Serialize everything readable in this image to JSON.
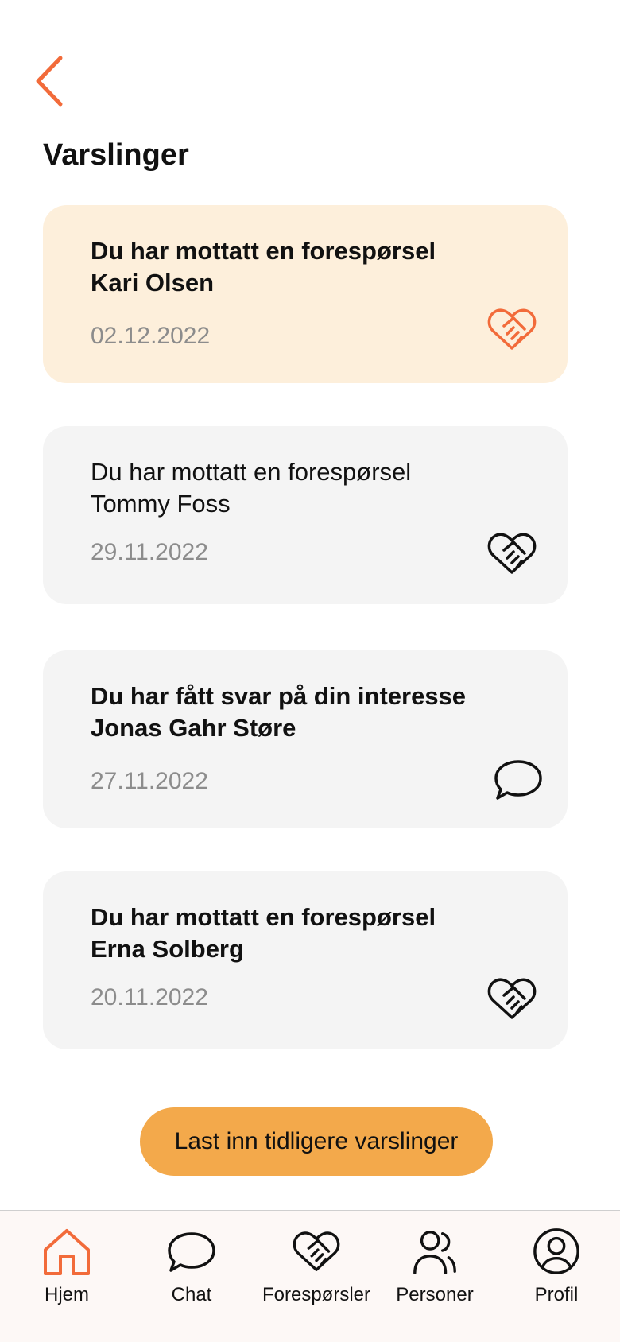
{
  "header": {
    "back_icon": "chevron-left-icon",
    "title": "Varslinger"
  },
  "notifications": [
    {
      "title": "Du har mottatt en forespørsel",
      "name": "Kari Olsen",
      "date": "02.12.2022",
      "icon": "handshake-heart-icon",
      "highlighted": true,
      "bold": true
    },
    {
      "title": "Du har mottatt en forespørsel",
      "name": "Tommy Foss",
      "date": "29.11.2022",
      "icon": "handshake-heart-icon",
      "highlighted": false,
      "bold": false
    },
    {
      "title": "Du har fått svar på din interesse",
      "name": "Jonas Gahr Støre",
      "date": "27.11.2022",
      "icon": "chat-bubble-icon",
      "highlighted": false,
      "bold": true
    },
    {
      "title": "Du har mottatt en forespørsel",
      "name": "Erna Solberg",
      "date": "20.11.2022",
      "icon": "handshake-heart-icon",
      "highlighted": false,
      "bold": true
    }
  ],
  "load_more_label": "Last inn tidligere varslinger",
  "nav": {
    "items": [
      {
        "label": "Hjem",
        "icon": "home-icon",
        "active": true
      },
      {
        "label": "Chat",
        "icon": "chat-bubble-icon",
        "active": false
      },
      {
        "label": "Forespørsler",
        "icon": "handshake-heart-icon",
        "active": false
      },
      {
        "label": "Personer",
        "icon": "people-icon",
        "active": false
      },
      {
        "label": "Profil",
        "icon": "profile-icon",
        "active": false
      }
    ]
  },
  "colors": {
    "accent": "#f26b3a",
    "button": "#f3a94b",
    "highlight_card": "#fdefdb",
    "card": "#f4f4f4",
    "date_text": "#8c8c8c"
  }
}
